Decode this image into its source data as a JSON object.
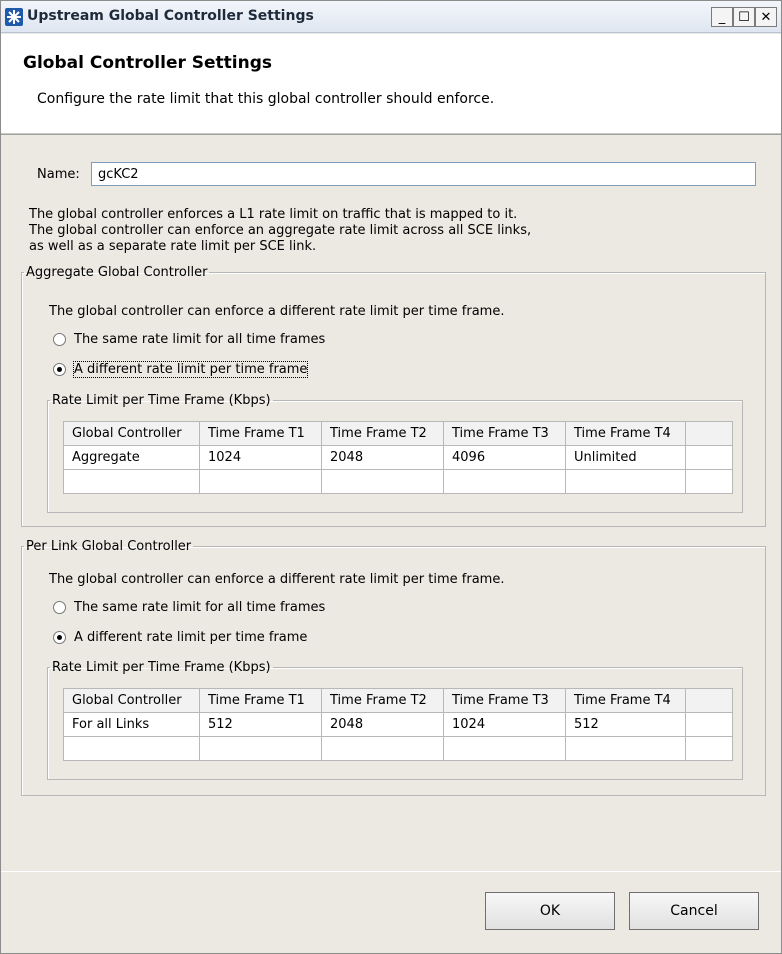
{
  "window": {
    "title": "Upstream Global Controller Settings",
    "controls": {
      "minimize": "_",
      "maximize": "☐",
      "close": "✕"
    }
  },
  "banner": {
    "title": "Global Controller Settings",
    "description": "Configure the rate limit that this global controller should enforce."
  },
  "name": {
    "label": "Name:",
    "value": "gcKC2"
  },
  "info": [
    "The global controller enforces a L1 rate limit on traffic that is mapped to it.",
    "The global controller can enforce an aggregate rate limit across all SCE links,",
    "as well as a separate rate limit per SCE link."
  ],
  "aggregate": {
    "legend": "Aggregate Global Controller",
    "description": "The global controller can enforce a different rate limit per time frame.",
    "radios": [
      {
        "label": "The same rate limit for all time frames",
        "checked": false
      },
      {
        "label": "A different rate limit per time frame",
        "checked": true
      }
    ],
    "table_legend": "Rate Limit per Time Frame (Kbps)",
    "columns": [
      "Global Controller",
      "Time Frame T1",
      "Time Frame T2",
      "Time Frame T3",
      "Time Frame T4"
    ],
    "rows": [
      [
        "Aggregate",
        "1024",
        "2048",
        "4096",
        "Unlimited"
      ]
    ]
  },
  "per_link": {
    "legend": "Per Link Global Controller",
    "description": "The global controller can enforce a different rate limit per time frame.",
    "radios": [
      {
        "label": "The same rate limit for all time frames",
        "checked": false
      },
      {
        "label": "A different rate limit per time frame",
        "checked": true
      }
    ],
    "table_legend": "Rate Limit per Time Frame (Kbps)",
    "columns": [
      "Global Controller",
      "Time Frame T1",
      "Time Frame T2",
      "Time Frame T3",
      "Time Frame T4"
    ],
    "rows": [
      [
        "For all Links",
        "512",
        "2048",
        "1024",
        "512"
      ]
    ]
  },
  "buttons": {
    "ok": "OK",
    "cancel": "Cancel"
  },
  "colors": {
    "title_icon": "#1f5aa8"
  }
}
